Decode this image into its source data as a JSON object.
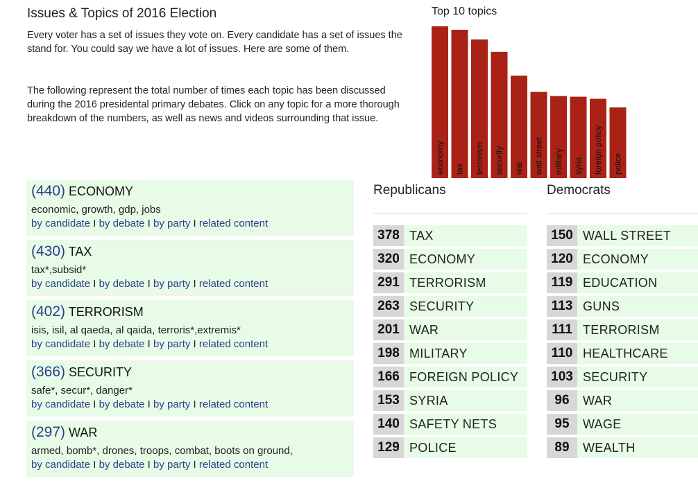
{
  "title": "Issues & Topics of 2016 Election",
  "intro": [
    "Every voter has a set of issues they vote on. Every candidate has a set of issues the stand for. You could say we have a lot of issues. Here are some of them.",
    "The following represent the total number of times each topic has been discussed during the 2016 presidental primary debates. Click on any topic for a more thorough breakdown of the numbers, as well as news and videos surrounding that issue."
  ],
  "links": {
    "by_candidate": "by candidate",
    "by_debate": "by debate",
    "by_party": "by party",
    "related": "related content",
    "sep": " I "
  },
  "topics": [
    {
      "count": "(440)",
      "name": "ECONOMY",
      "keywords": "economic, growth, gdp, jobs"
    },
    {
      "count": "(430)",
      "name": "TAX",
      "keywords": "tax*,subsid*"
    },
    {
      "count": "(402)",
      "name": "TERRORISM",
      "keywords": "isis, isil, al qaeda, al qaida, terroris*,extremis*"
    },
    {
      "count": "(366)",
      "name": "SECURITY",
      "keywords": "safe*, secur*, danger*"
    },
    {
      "count": "(297)",
      "name": "WAR",
      "keywords": "armed, bomb*, drones, troops, combat, boots on ground,"
    }
  ],
  "republicans": {
    "title": "Republicans",
    "rows": [
      {
        "count": "378",
        "name": "TAX"
      },
      {
        "count": "320",
        "name": "ECONOMY"
      },
      {
        "count": "291",
        "name": "TERRORISM"
      },
      {
        "count": "263",
        "name": "SECURITY"
      },
      {
        "count": "201",
        "name": "WAR"
      },
      {
        "count": "198",
        "name": "MILITARY"
      },
      {
        "count": "166",
        "name": "FOREIGN POLICY"
      },
      {
        "count": "153",
        "name": "SYRIA"
      },
      {
        "count": "140",
        "name": "SAFETY NETS"
      },
      {
        "count": "129",
        "name": "POLICE"
      }
    ]
  },
  "democrats": {
    "title": "Democrats",
    "rows": [
      {
        "count": "150",
        "name": "WALL STREET"
      },
      {
        "count": "120",
        "name": "ECONOMY"
      },
      {
        "count": "119",
        "name": "EDUCATION"
      },
      {
        "count": "113",
        "name": "GUNS"
      },
      {
        "count": "111",
        "name": "TERRORISM"
      },
      {
        "count": "110",
        "name": "HEALTHCARE"
      },
      {
        "count": "103",
        "name": "SECURITY"
      },
      {
        "count": "96",
        "name": "WAR"
      },
      {
        "count": "95",
        "name": "WAGE"
      },
      {
        "count": "89",
        "name": "WEALTH"
      }
    ]
  },
  "chart_data": {
    "type": "bar",
    "title": "Top 10 topics",
    "categories": [
      "economy",
      "tax",
      "terrorism",
      "security",
      "war",
      "wall street",
      "military",
      "syria",
      "foreign policy",
      "police"
    ],
    "values": [
      440,
      430,
      402,
      366,
      297,
      250,
      238,
      236,
      230,
      205
    ],
    "ylim": [
      0,
      440
    ],
    "bar_color": "#aa2216",
    "grid": false,
    "legend": "none"
  }
}
